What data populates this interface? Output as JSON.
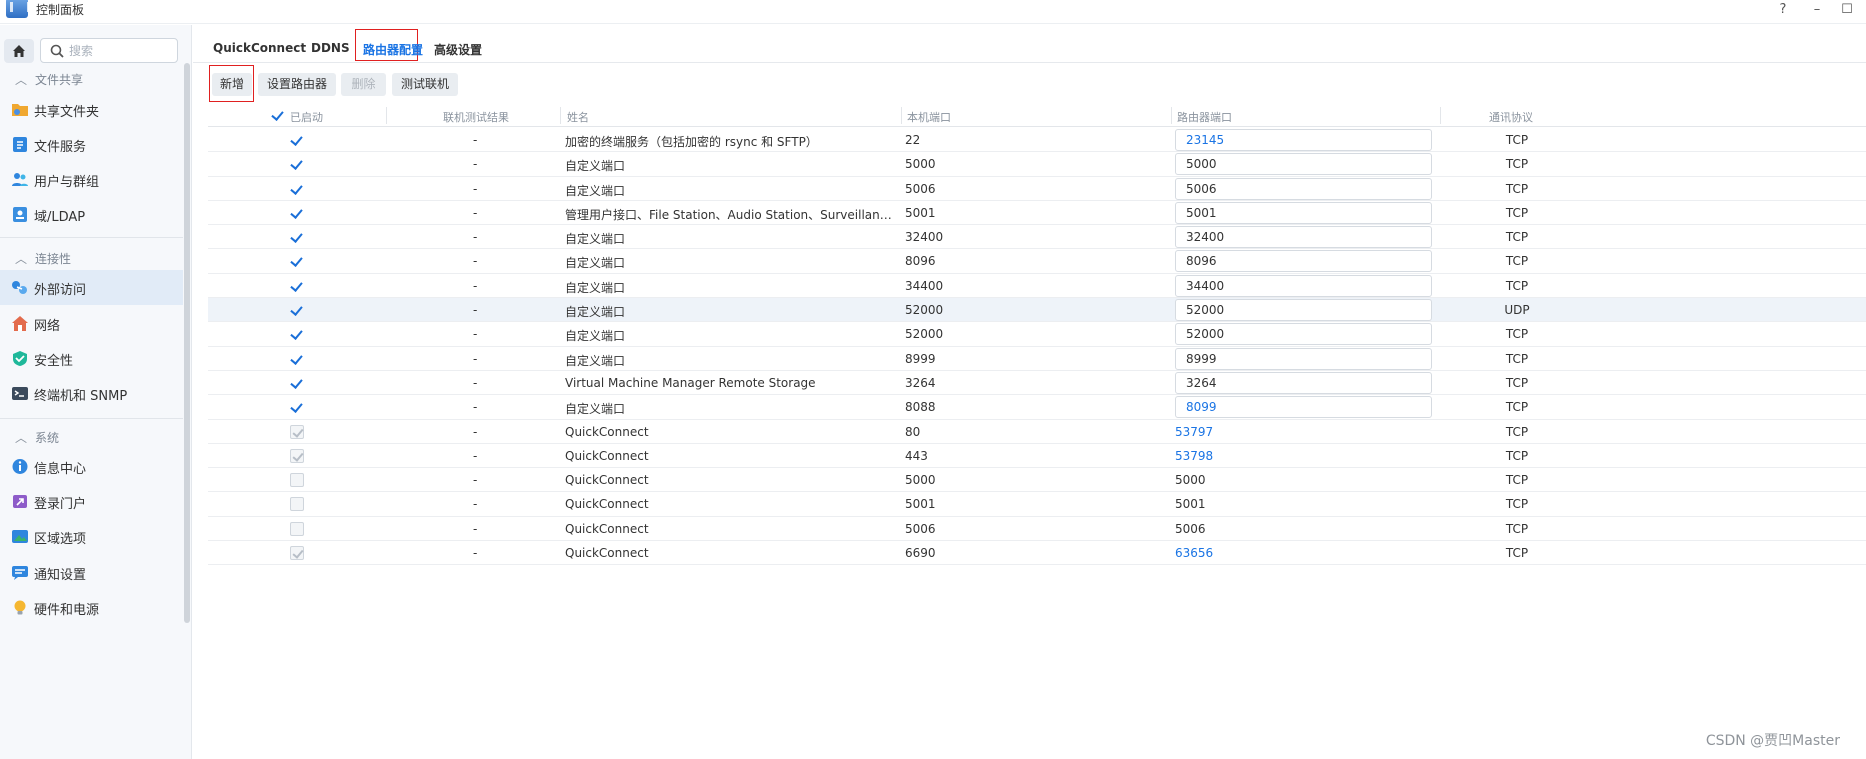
{
  "app": {
    "title": "控制面板"
  },
  "window_buttons": {
    "help": "?",
    "minimize": "–",
    "maximize": "☐"
  },
  "sidebar": {
    "search_placeholder": "搜索",
    "sections": [
      {
        "title": "文件共享",
        "items": [
          {
            "label": "共享文件夹",
            "icon": "shared-folder-icon"
          },
          {
            "label": "文件服务",
            "icon": "file-services-icon"
          },
          {
            "label": "用户与群组",
            "icon": "users-groups-icon"
          },
          {
            "label": "域/LDAP",
            "icon": "domain-ldap-icon"
          }
        ]
      },
      {
        "title": "连接性",
        "items": [
          {
            "label": "外部访问",
            "icon": "external-access-icon",
            "active": true
          },
          {
            "label": "网络",
            "icon": "network-icon"
          },
          {
            "label": "安全性",
            "icon": "security-icon"
          },
          {
            "label": "终端机和 SNMP",
            "icon": "terminal-snmp-icon"
          }
        ]
      },
      {
        "title": "系统",
        "items": [
          {
            "label": "信息中心",
            "icon": "info-center-icon"
          },
          {
            "label": "登录门户",
            "icon": "login-portal-icon"
          },
          {
            "label": "区域选项",
            "icon": "regional-options-icon"
          },
          {
            "label": "通知设置",
            "icon": "notification-icon"
          },
          {
            "label": "硬件和电源",
            "icon": "hardware-power-icon"
          }
        ]
      }
    ]
  },
  "tabs": [
    {
      "label": "QuickConnect"
    },
    {
      "label": "DDNS"
    },
    {
      "label": "路由器配置",
      "active": true
    },
    {
      "label": "高级设置"
    }
  ],
  "toolbar": {
    "add": "新增",
    "setup_router": "设置路由器",
    "delete": "删除",
    "test": "测试联机"
  },
  "columns": {
    "enabled": "已启动",
    "test_result": "联机测试结果",
    "name": "姓名",
    "local_port": "本机端口",
    "router_port": "路由器端口",
    "protocol": "通讯协议"
  },
  "rows": [
    {
      "checked": "on",
      "test": "-",
      "name": "加密的终端服务（包括加密的 rsync 和 SFTP）",
      "local": "22",
      "router": "23145",
      "router_style": "input-link",
      "protocol": "TCP"
    },
    {
      "checked": "on",
      "test": "-",
      "name": "自定义端口",
      "local": "5000",
      "router": "5000",
      "router_style": "input",
      "protocol": "TCP"
    },
    {
      "checked": "on",
      "test": "-",
      "name": "自定义端口",
      "local": "5006",
      "router": "5006",
      "router_style": "input",
      "protocol": "TCP"
    },
    {
      "checked": "on",
      "test": "-",
      "name": "管理用户接口、File Station、Audio Station、Surveillance Station…",
      "local": "5001",
      "router": "5001",
      "router_style": "input",
      "protocol": "TCP"
    },
    {
      "checked": "on",
      "test": "-",
      "name": "自定义端口",
      "local": "32400",
      "router": "32400",
      "router_style": "input",
      "protocol": "TCP"
    },
    {
      "checked": "on",
      "test": "-",
      "name": "自定义端口",
      "local": "8096",
      "router": "8096",
      "router_style": "input",
      "protocol": "TCP"
    },
    {
      "checked": "on",
      "test": "-",
      "name": "自定义端口",
      "local": "34400",
      "router": "34400",
      "router_style": "input",
      "protocol": "TCP"
    },
    {
      "checked": "on",
      "test": "-",
      "name": "自定义端口",
      "local": "52000",
      "router": "52000",
      "router_style": "input",
      "protocol": "UDP",
      "highlight": true
    },
    {
      "checked": "on",
      "test": "-",
      "name": "自定义端口",
      "local": "52000",
      "router": "52000",
      "router_style": "input",
      "protocol": "TCP"
    },
    {
      "checked": "on",
      "test": "-",
      "name": "自定义端口",
      "local": "8999",
      "router": "8999",
      "router_style": "input",
      "protocol": "TCP"
    },
    {
      "checked": "on",
      "test": "-",
      "name": "Virtual Machine Manager Remote Storage",
      "local": "3264",
      "router": "3264",
      "router_style": "input",
      "protocol": "TCP"
    },
    {
      "checked": "on",
      "test": "-",
      "name": "自定义端口",
      "local": "8088",
      "router": "8099",
      "router_style": "input-link",
      "protocol": "TCP"
    },
    {
      "checked": "ghost-checked",
      "test": "-",
      "name": "QuickConnect",
      "local": "80",
      "router": "53797",
      "router_style": "link",
      "protocol": "TCP"
    },
    {
      "checked": "ghost-checked",
      "test": "-",
      "name": "QuickConnect",
      "local": "443",
      "router": "53798",
      "router_style": "link",
      "protocol": "TCP"
    },
    {
      "checked": "ghost",
      "test": "-",
      "name": "QuickConnect",
      "local": "5000",
      "router": "5000",
      "router_style": "plain",
      "protocol": "TCP"
    },
    {
      "checked": "ghost",
      "test": "-",
      "name": "QuickConnect",
      "local": "5001",
      "router": "5001",
      "router_style": "plain",
      "protocol": "TCP"
    },
    {
      "checked": "ghost",
      "test": "-",
      "name": "QuickConnect",
      "local": "5006",
      "router": "5006",
      "router_style": "plain",
      "protocol": "TCP"
    },
    {
      "checked": "ghost-checked",
      "test": "-",
      "name": "QuickConnect",
      "local": "6690",
      "router": "63656",
      "router_style": "link",
      "protocol": "TCP"
    }
  ],
  "watermark": "CSDN @贾凹Master"
}
